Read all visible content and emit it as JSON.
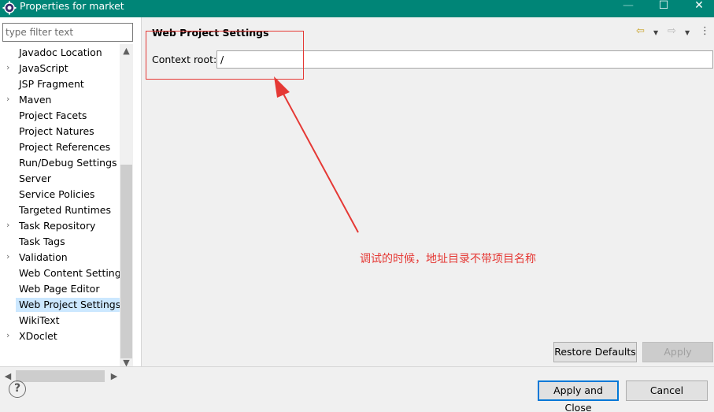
{
  "window": {
    "title": "Properties for market",
    "icon": "eclipse-gear-icon",
    "buttons": {
      "minimize": "—",
      "maximize": "☐",
      "close": "✕"
    }
  },
  "sidebar": {
    "filter_placeholder": "type filter text",
    "filter_value": "",
    "items": [
      {
        "label": "Javadoc Location",
        "expandable": false,
        "selected": false
      },
      {
        "label": "JavaScript",
        "expandable": true,
        "selected": false
      },
      {
        "label": "JSP Fragment",
        "expandable": false,
        "selected": false
      },
      {
        "label": "Maven",
        "expandable": true,
        "selected": false
      },
      {
        "label": "Project Facets",
        "expandable": false,
        "selected": false
      },
      {
        "label": "Project Natures",
        "expandable": false,
        "selected": false
      },
      {
        "label": "Project References",
        "expandable": false,
        "selected": false
      },
      {
        "label": "Run/Debug Settings",
        "expandable": false,
        "selected": false
      },
      {
        "label": "Server",
        "expandable": false,
        "selected": false
      },
      {
        "label": "Service Policies",
        "expandable": false,
        "selected": false
      },
      {
        "label": "Targeted Runtimes",
        "expandable": false,
        "selected": false
      },
      {
        "label": "Task Repository",
        "expandable": true,
        "selected": false
      },
      {
        "label": "Task Tags",
        "expandable": false,
        "selected": false
      },
      {
        "label": "Validation",
        "expandable": true,
        "selected": false
      },
      {
        "label": "Web Content Settings",
        "expandable": false,
        "selected": false
      },
      {
        "label": "Web Page Editor",
        "expandable": false,
        "selected": false
      },
      {
        "label": "Web Project Settings",
        "expandable": false,
        "selected": true
      },
      {
        "label": "WikiText",
        "expandable": false,
        "selected": false
      },
      {
        "label": "XDoclet",
        "expandable": true,
        "selected": false
      }
    ]
  },
  "page": {
    "title": "Web Project Settings",
    "context_root_label": "Context root:",
    "context_root_value": "/"
  },
  "annotation": {
    "text": "调试的时候，地址目录不带项目名称",
    "color": "#e53935"
  },
  "buttons": {
    "restore_defaults": "Restore Defaults",
    "apply": "Apply",
    "apply_and_close": "Apply and Close",
    "cancel": "Cancel",
    "help": "?"
  },
  "colors": {
    "titlebar": "#008577",
    "selection": "#cce8ff",
    "focus_border": "#0078d7"
  }
}
